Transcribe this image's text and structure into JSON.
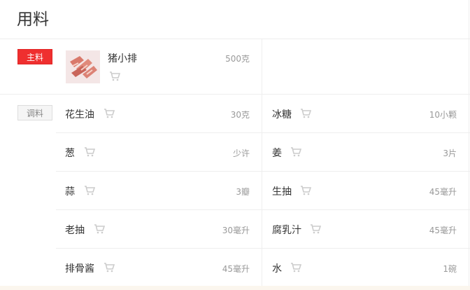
{
  "section": {
    "title": "用料"
  },
  "main_ingredients": {
    "tag_label": "主料",
    "items": [
      {
        "name": "猪小排",
        "amount": "500克"
      }
    ]
  },
  "seasonings": {
    "tag_label": "调料",
    "rows": [
      {
        "left": {
          "name": "花生油",
          "amount": "30克"
        },
        "right": {
          "name": "冰糖",
          "amount": "10小颗"
        }
      },
      {
        "left": {
          "name": "葱",
          "amount": "少许"
        },
        "right": {
          "name": "姜",
          "amount": "3片"
        }
      },
      {
        "left": {
          "name": "蒜",
          "amount": "3瓣"
        },
        "right": {
          "name": "生抽",
          "amount": "45毫升"
        }
      },
      {
        "left": {
          "name": "老抽",
          "amount": "30毫升"
        },
        "right": {
          "name": "腐乳汁",
          "amount": "45毫升"
        }
      },
      {
        "left": {
          "name": "排骨酱",
          "amount": "45毫升"
        },
        "right": {
          "name": "水",
          "amount": "1碗"
        }
      }
    ]
  },
  "colors": {
    "main_tag_bg": "#ef2f2f",
    "seasoning_tag_bg": "#f5f5f5",
    "divider": "#eeeeee",
    "cart_icon": "#cccccc"
  }
}
